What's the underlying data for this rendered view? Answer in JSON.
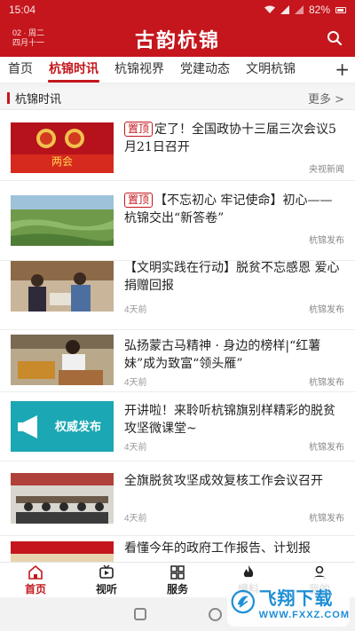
{
  "status_bar": {
    "time": "15:04",
    "battery": "82%"
  },
  "header": {
    "date_line1": "02 · 周二",
    "date_line2": "四月十一",
    "title": "古韵杭锦"
  },
  "tabs": [
    {
      "label": "首页"
    },
    {
      "label": "杭锦时讯"
    },
    {
      "label": "杭锦视界"
    },
    {
      "label": "党建动态"
    },
    {
      "label": "文明杭锦"
    }
  ],
  "tab_more": "+",
  "section": {
    "title": "杭锦时讯",
    "more": "更多 >"
  },
  "news": [
    {
      "tag": "置顶",
      "title": "定了！全国政协十三届三次会议5月21日召开",
      "time": "",
      "source": "央视新闻",
      "thumb_text": "两会"
    },
    {
      "tag": "置顶",
      "title": "【不忘初心 牢记使命】初心——杭锦交出“新答卷”",
      "time": "",
      "source": "杭锦发布",
      "thumb_text": ""
    },
    {
      "tag": "",
      "title": "【文明实践在行动】脱贫不忘感恩 爱心捐赠回报",
      "time": "4天前",
      "source": "杭锦发布",
      "thumb_text": ""
    },
    {
      "tag": "",
      "title": "弘扬蒙古马精神 · 身边的榜样|“红薯妹”成为致富“领头雁”",
      "time": "4天前",
      "source": "杭锦发布",
      "thumb_text": ""
    },
    {
      "tag": "",
      "title": "开讲啦！来聆听杭锦旗别样精彩的脱贫攻坚微课堂~",
      "time": "4天前",
      "source": "杭锦发布",
      "thumb_text": "权威发布"
    },
    {
      "tag": "",
      "title": "全旗脱贫攻坚成效复核工作会议召开",
      "time": "4天前",
      "source": "杭锦发布",
      "thumb_text": ""
    },
    {
      "tag": "",
      "title": "看懂今年的政府工作报告、计划报",
      "time": "",
      "source": "",
      "thumb_text": ""
    }
  ],
  "bottom_nav": [
    {
      "label": "首页",
      "icon": "home-icon",
      "active": true
    },
    {
      "label": "视听",
      "icon": "tv-icon",
      "active": false
    },
    {
      "label": "服务",
      "icon": "grid-icon",
      "active": false
    },
    {
      "label": "爆料",
      "icon": "fire-icon",
      "active": false
    },
    {
      "label": "我的",
      "icon": "user-icon",
      "active": false
    }
  ],
  "watermark": {
    "main": "飞翔下载",
    "sub": "WWW.FXXZ.COM"
  },
  "colors": {
    "brand_red": "#c4161c",
    "watermark_blue": "#1e8fd6"
  }
}
